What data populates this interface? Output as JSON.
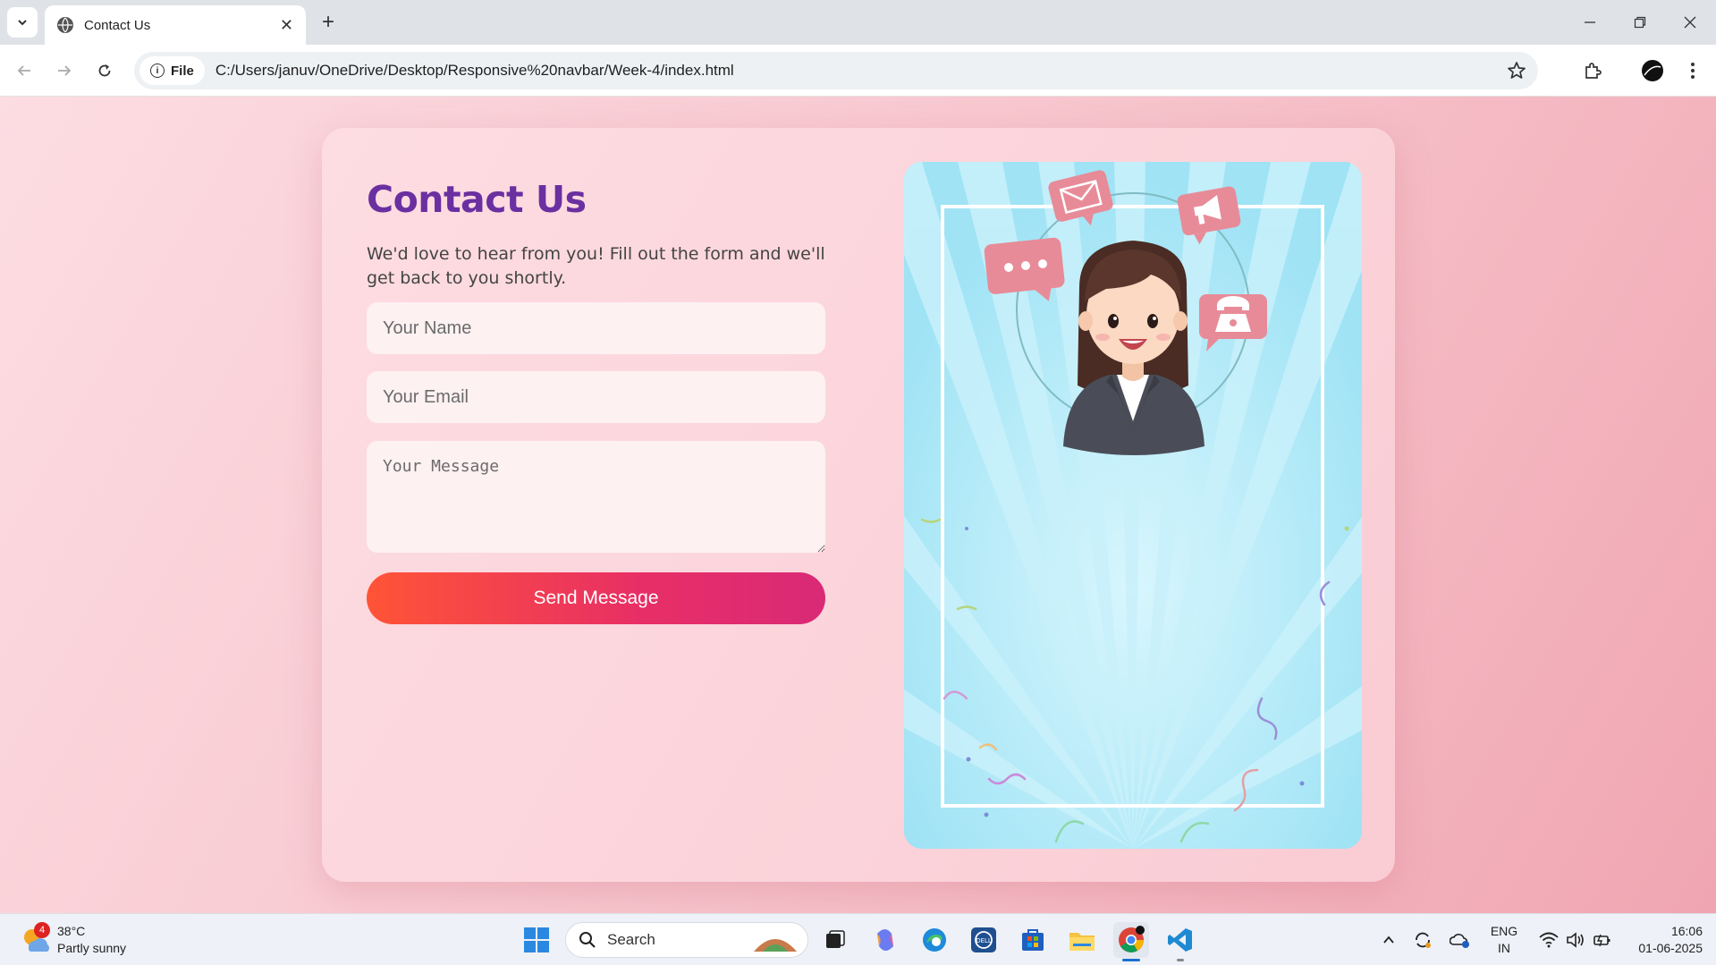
{
  "browser": {
    "tab_title": "Contact Us",
    "address_chip": "File",
    "url": "C:/Users/januv/OneDrive/Desktop/Responsive%20navbar/Week-4/index.html"
  },
  "page": {
    "heading": "Contact Us",
    "subtitle": "We'd love to hear from you! Fill out the form and we'll get back to you shortly.",
    "form": {
      "name_placeholder": "Your Name",
      "name_value": "",
      "email_placeholder": "Your Email",
      "email_value": "",
      "message_placeholder": "Your Message",
      "message_value": "",
      "submit_label": "Send Message"
    },
    "colors": {
      "heading": "#6a2fa0",
      "button_start": "#ff5436",
      "button_end": "#d92a77",
      "illustration_bg": "#a6e6f6"
    }
  },
  "taskbar": {
    "weather_temp": "38°C",
    "weather_desc": "Partly sunny",
    "weather_badge": "4",
    "search_label": "Search",
    "lang_top": "ENG",
    "lang_bottom": "IN",
    "time": "16:06",
    "date": "01-06-2025"
  }
}
